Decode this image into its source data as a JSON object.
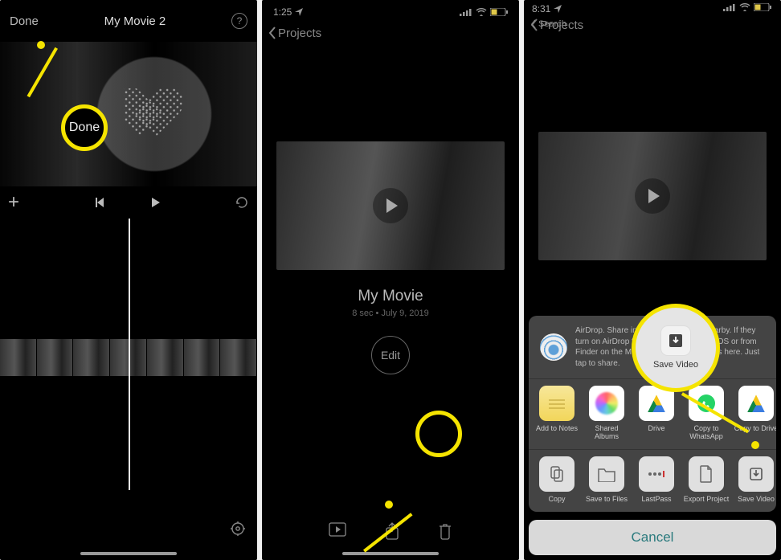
{
  "annotation_color": "#f5e400",
  "panel1": {
    "done": "Done",
    "title": "My Movie 2",
    "help": "?",
    "done_bubble": "Done"
  },
  "panel2": {
    "status_time": "1:25",
    "back": "Projects",
    "movie_title": "My Movie",
    "movie_meta": "8 sec • July 9, 2019",
    "edit": "Edit"
  },
  "panel3": {
    "status_time": "8:31",
    "search_back": "Search",
    "back": "Projects",
    "airdrop_text": "AirDrop. Share instantly with people nearby. If they turn on AirDrop from Control Center on iOS or from Finder on the Mac, you'll see their names here. Just tap to share.",
    "save_bubble_label": "Save Video",
    "apps": [
      {
        "label": "Add to Notes",
        "icon": "notes"
      },
      {
        "label": "Shared Albums",
        "icon": "photos"
      },
      {
        "label": "Drive",
        "icon": "drive"
      },
      {
        "label": "Copy to WhatsApp",
        "icon": "whatsapp"
      },
      {
        "label": "Copy to Drive",
        "icon": "gdrive"
      }
    ],
    "actions": [
      {
        "label": "Copy",
        "glyph": "copy"
      },
      {
        "label": "Save to Files",
        "glyph": "folder"
      },
      {
        "label": "LastPass",
        "glyph": "dots"
      },
      {
        "label": "Export Project",
        "glyph": "file"
      },
      {
        "label": "Save Video",
        "glyph": "save"
      }
    ],
    "cancel": "Cancel"
  }
}
